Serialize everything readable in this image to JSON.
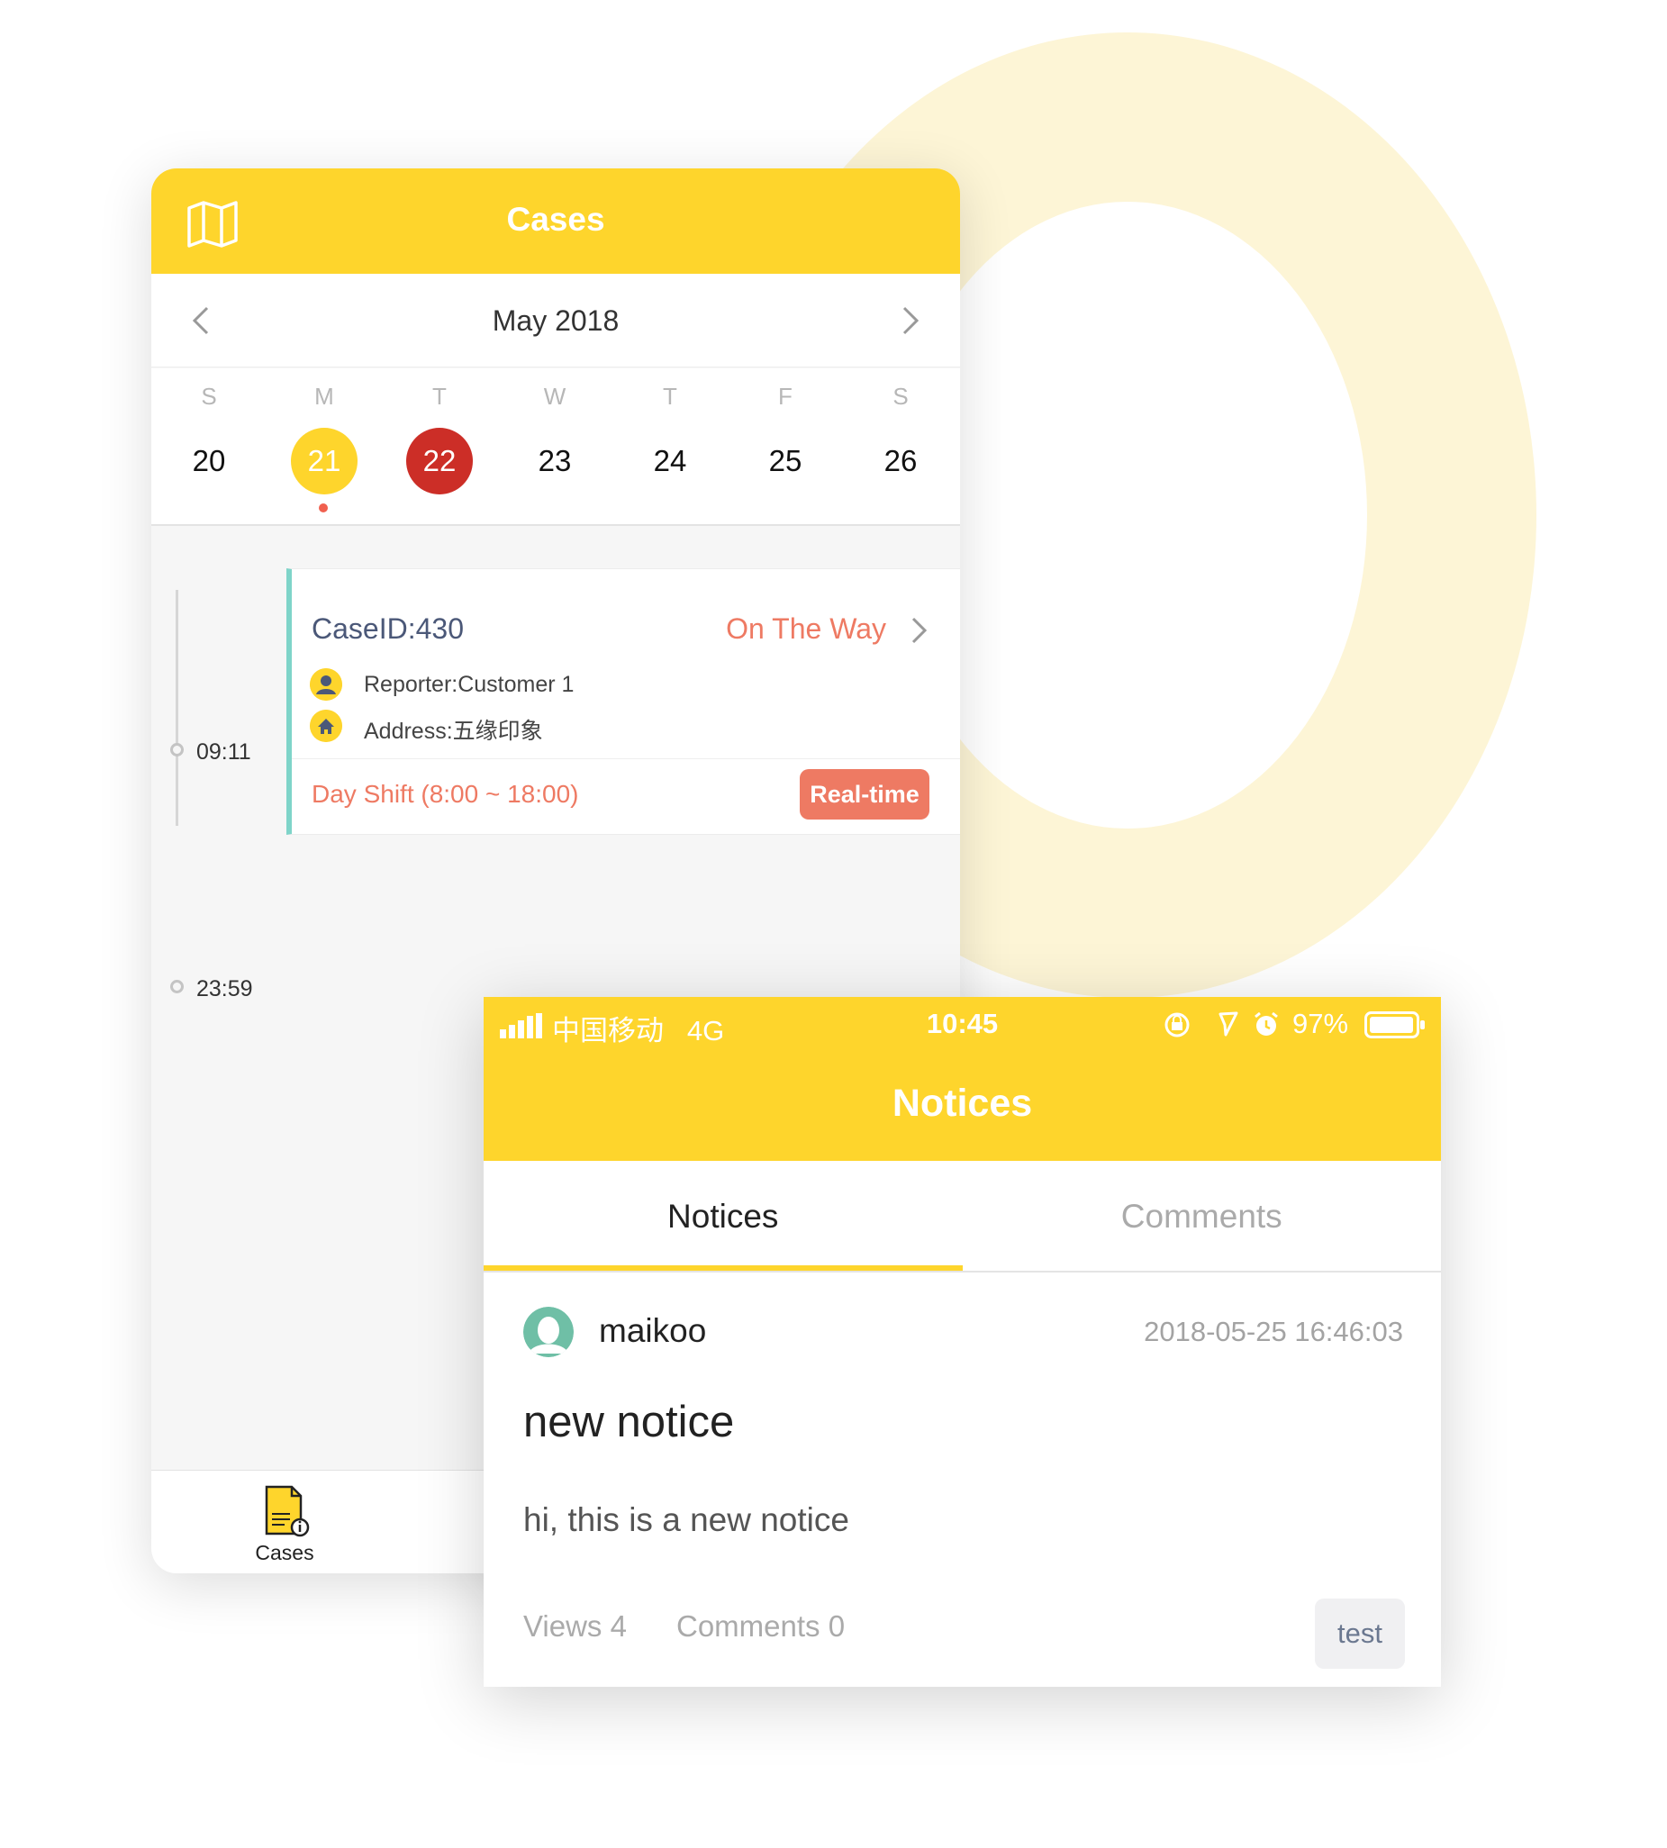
{
  "cases_screen": {
    "title": "Cases",
    "calendar": {
      "month_label": "May 2018",
      "weekdays": [
        "S",
        "M",
        "T",
        "W",
        "T",
        "F",
        "S"
      ],
      "days": [
        "20",
        "21",
        "22",
        "23",
        "24",
        "25",
        "26"
      ],
      "selected_day": "21",
      "today": "22"
    },
    "timeline": {
      "start_time": "09:11",
      "end_time": "23:59"
    },
    "case": {
      "id": "CaseID:430",
      "status": "On The Way",
      "reporter": "Reporter:Customer 1",
      "address": "Address:五缘印象",
      "shift": "Day Shift (8:00 ~ 18:00)",
      "badge": "Real-time"
    },
    "tabbar": {
      "cases_label": "Cases"
    }
  },
  "notices_screen": {
    "status_bar": {
      "carrier": "中国移动",
      "network": "4G",
      "time": "10:45",
      "battery": "97%"
    },
    "title": "Notices",
    "tabs": [
      {
        "label": "Notices",
        "active": true
      },
      {
        "label": "Comments",
        "active": false
      }
    ],
    "notice": {
      "author": "maikoo",
      "timestamp": "2018-05-25 16:46:03",
      "title": "new notice",
      "body": "hi, this is a new notice",
      "views": "Views 4",
      "comments": "Comments 0",
      "tag": "test"
    }
  },
  "colors": {
    "brand_yellow": "#fed52c",
    "accent_coral": "#ee7a63",
    "today_red": "#cc2e27",
    "timeline_teal": "#7fd4c9",
    "ring_tint": "#fdf5d6"
  },
  "icons": [
    "map-icon",
    "chevron-left-icon",
    "chevron-right-icon",
    "reporter-icon",
    "home-icon",
    "cases-doc-icon",
    "signal-icon",
    "battery-icon",
    "avatar-icon"
  ]
}
